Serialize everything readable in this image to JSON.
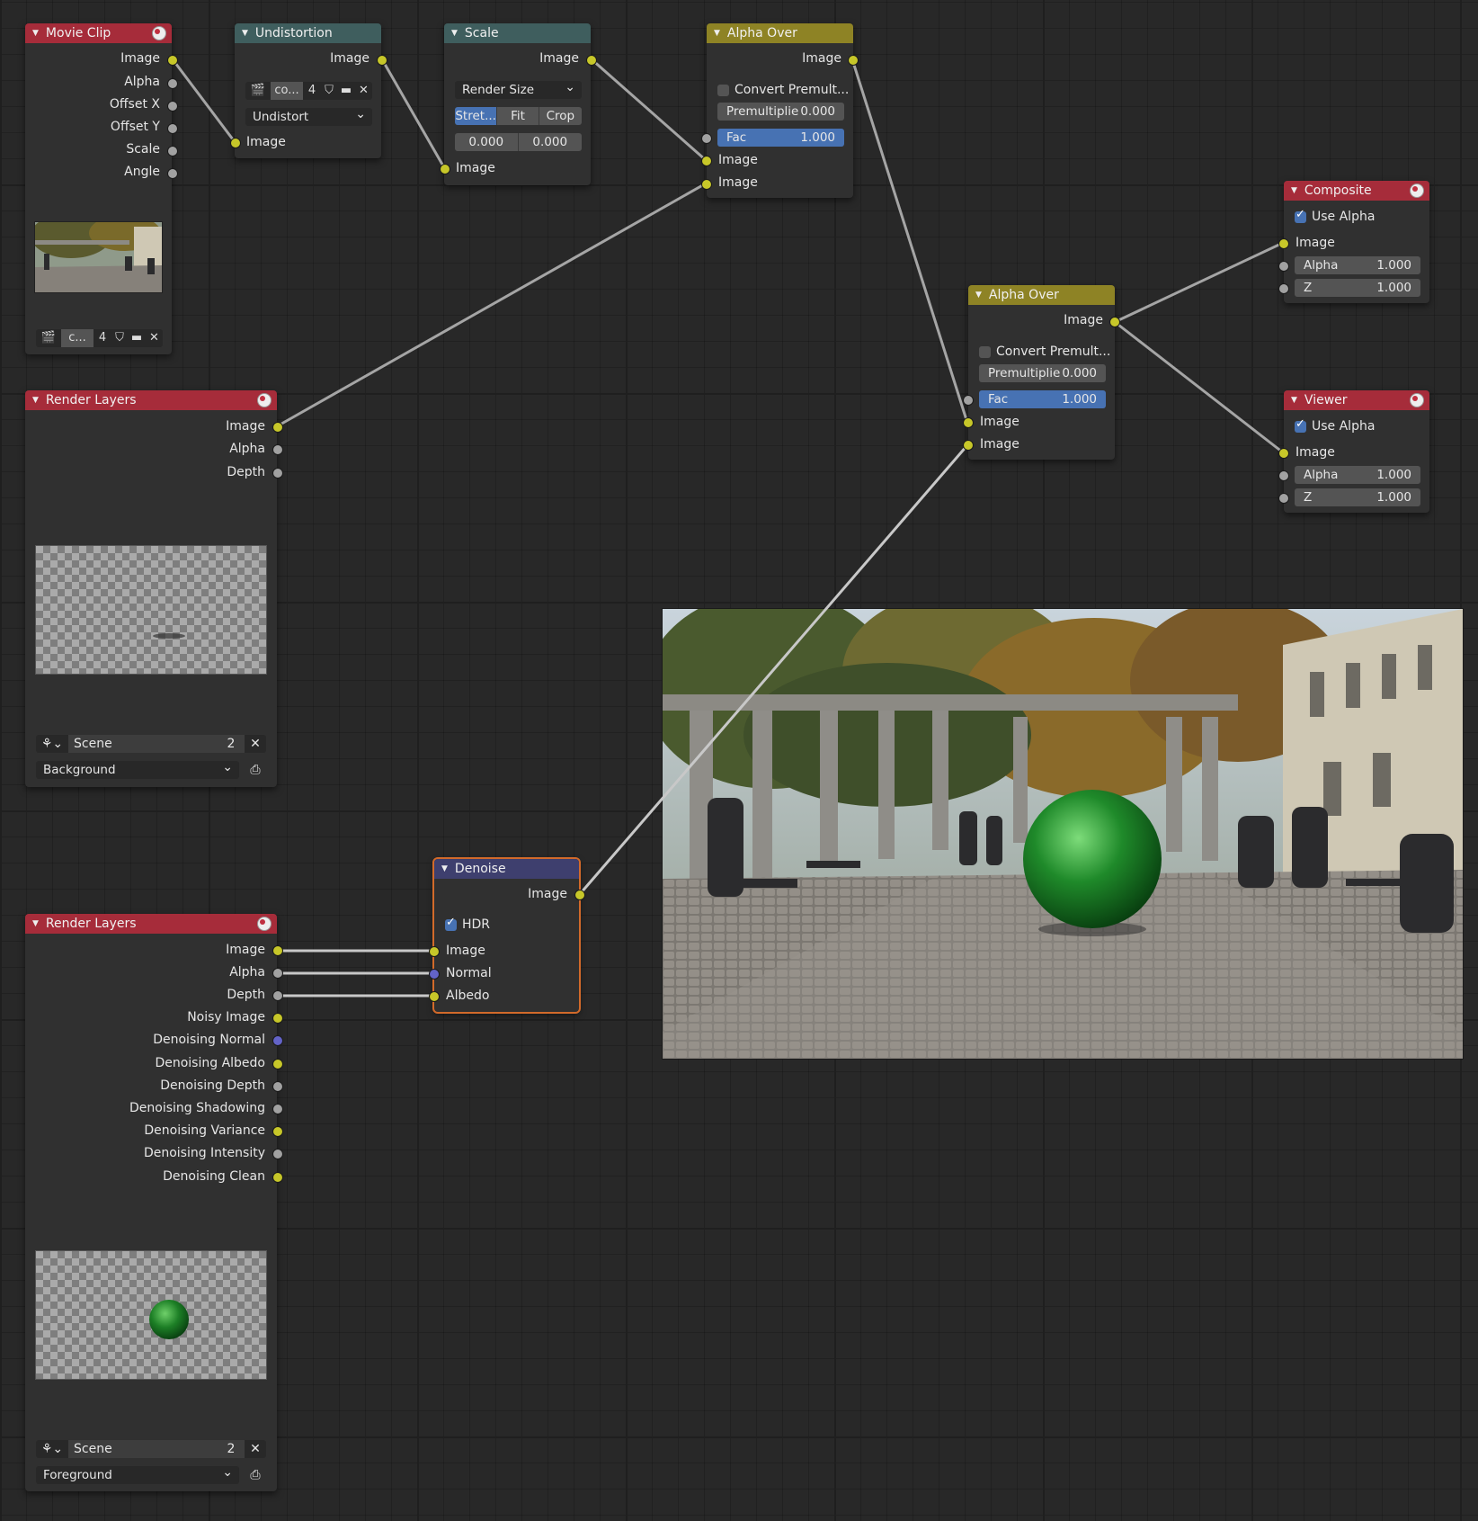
{
  "movie_clip": {
    "title": "Movie Clip",
    "outputs": [
      "Image",
      "Alpha",
      "Offset X",
      "Offset Y",
      "Scale",
      "Angle"
    ],
    "clip_name": "c...",
    "users": "4"
  },
  "undistortion": {
    "title": "Undistortion",
    "output": "Image",
    "clip_name": "co...",
    "users": "4",
    "mode": "Undistort",
    "input": "Image"
  },
  "scale": {
    "title": "Scale",
    "output": "Image",
    "space": "Render Size",
    "frame_modes": [
      "Stret...",
      "Fit",
      "Crop"
    ],
    "active_mode": "Stret...",
    "offset_x": "0.000",
    "offset_y": "0.000",
    "input": "Image"
  },
  "alpha_over_1": {
    "title": "Alpha Over",
    "output": "Image",
    "convert_premult": "Convert Premult...",
    "premultiply_label": "Premultiplie",
    "premultiply_value": "0.000",
    "fac_label": "Fac",
    "fac_value": "1.000",
    "input1": "Image",
    "input2": "Image"
  },
  "alpha_over_2": {
    "title": "Alpha Over",
    "output": "Image",
    "convert_premult": "Convert Premult...",
    "premultiply_label": "Premultiplie",
    "premultiply_value": "0.000",
    "fac_label": "Fac",
    "fac_value": "1.000",
    "input1": "Image",
    "input2": "Image"
  },
  "composite": {
    "title": "Composite",
    "use_alpha": "Use Alpha",
    "input": "Image",
    "alpha_label": "Alpha",
    "alpha_value": "1.000",
    "z_label": "Z",
    "z_value": "1.000"
  },
  "viewer": {
    "title": "Viewer",
    "use_alpha": "Use Alpha",
    "input": "Image",
    "alpha_label": "Alpha",
    "alpha_value": "1.000",
    "z_label": "Z",
    "z_value": "1.000"
  },
  "render_layers_bg": {
    "title": "Render Layers",
    "outputs": [
      "Image",
      "Alpha",
      "Depth"
    ],
    "scene": "Scene",
    "scene_users": "2",
    "layer": "Background"
  },
  "render_layers_fg": {
    "title": "Render Layers",
    "outputs": [
      "Image",
      "Alpha",
      "Depth",
      "Noisy Image",
      "Denoising Normal",
      "Denoising Albedo",
      "Denoising Depth",
      "Denoising Shadowing",
      "Denoising Variance",
      "Denoising Intensity",
      "Denoising Clean"
    ],
    "scene": "Scene",
    "scene_users": "2",
    "layer": "Foreground"
  },
  "denoise": {
    "title": "Denoise",
    "output": "Image",
    "hdr": "HDR",
    "inputs": [
      "Image",
      "Normal",
      "Albedo"
    ]
  },
  "colors": {
    "input_node_header": "#a62c3a",
    "distort_node_header": "#3f5e5e",
    "color_node_header": "#8e8325",
    "filter_node_header": "#3e3f6e",
    "image_socket": "#c7c729",
    "float_socket": "#a1a1a1",
    "vector_socket": "#6363c7",
    "active_button": "#4772b3"
  }
}
